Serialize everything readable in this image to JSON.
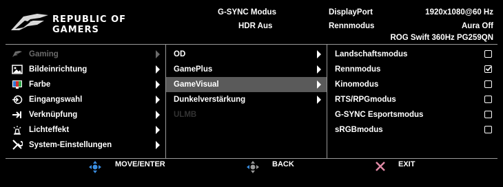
{
  "header": {
    "logo_line1": "REPUBLIC OF",
    "logo_line2": "GAMERS",
    "gsync": "G-SYNC Modus",
    "hdr": "HDR Aus",
    "input": "DisplayPort",
    "mode": "Rennmodus",
    "resolution": "1920x1080@60 Hz",
    "aura": "Aura Off",
    "model": "ROG Swift 360Hz PG259QN"
  },
  "main_menu": [
    {
      "label": "Gaming",
      "icon": "gamepad-icon"
    },
    {
      "label": "Bildeinrichtung",
      "icon": "image-icon"
    },
    {
      "label": "Farbe",
      "icon": "color-icon"
    },
    {
      "label": "Eingangswahl",
      "icon": "input-icon"
    },
    {
      "label": "Verknüpfung",
      "icon": "shortcut-icon"
    },
    {
      "label": "Lichteffekt",
      "icon": "light-effect-icon"
    },
    {
      "label": "System-Einstellungen",
      "icon": "wrench-icon"
    }
  ],
  "sub_menu": [
    {
      "label": "OD"
    },
    {
      "label": "GamePlus"
    },
    {
      "label": "GameVisual"
    },
    {
      "label": "Dunkelverstärkung"
    },
    {
      "label": "ULMB"
    }
  ],
  "options": [
    {
      "label": "Landschaftsmodus",
      "checked": false
    },
    {
      "label": "Rennmodus",
      "checked": true
    },
    {
      "label": "Kinomodus",
      "checked": false
    },
    {
      "label": "RTS/RPGmodus",
      "checked": false
    },
    {
      "label": "G-SYNC Esportsmodus",
      "checked": false
    },
    {
      "label": "sRGBmodus",
      "checked": false
    }
  ],
  "footer": {
    "move": "MOVE/ENTER",
    "back": "BACK",
    "exit": "EXIT"
  },
  "colors": {
    "selected_bg": "#5a5a5a",
    "joystick_blue": "#3a8de0",
    "exit_pink": "#e08aa6"
  }
}
